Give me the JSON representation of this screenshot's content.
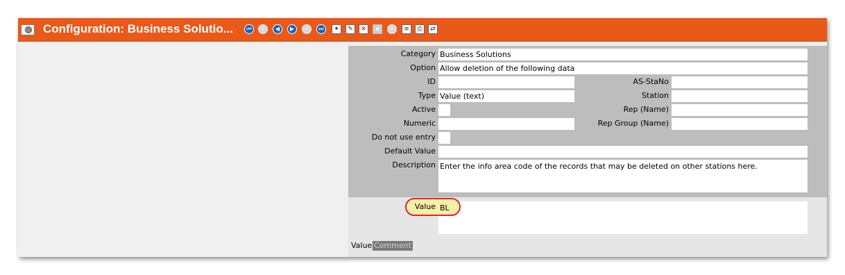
{
  "window": {
    "title": "Configuration: Business Solutio...",
    "accent": "#e8591a"
  },
  "toolbar": {
    "icons": [
      "first-record-icon",
      "previous-page-disabled-icon",
      "previous-record-icon",
      "next-record-icon",
      "next-page-disabled-icon",
      "last-record-icon",
      "new-record-icon",
      "edit-record-icon",
      "delete-record-icon",
      "save-disabled-icon",
      "cancel-disabled-icon",
      "list-view-icon",
      "print-icon",
      "export-icon"
    ]
  },
  "form": {
    "category": {
      "label": "Category",
      "value": "Business Solutions"
    },
    "option": {
      "label": "Option",
      "value": "Allow deletion of the following data"
    },
    "id": {
      "label": "ID",
      "value": ""
    },
    "as_stano": {
      "label": "AS-StaNo",
      "value": ""
    },
    "type": {
      "label": "Type",
      "value": "Value (text)"
    },
    "station": {
      "label": "Station",
      "value": ""
    },
    "active": {
      "label": "Active",
      "value": ""
    },
    "rep_name": {
      "label": "Rep (Name)",
      "value": ""
    },
    "numeric": {
      "label": "Numeric",
      "value": ""
    },
    "rep_group": {
      "label": "Rep Group (Name)",
      "value": ""
    },
    "do_not_use": {
      "label": "Do not use entry",
      "value": ""
    },
    "default_value": {
      "label": "Default Value",
      "value": ""
    },
    "description": {
      "label": "Description",
      "value": "Enter the info area code of the records that may be deleted on other stations here."
    },
    "value": {
      "label": "Value",
      "value": "BL"
    }
  },
  "tabs": [
    {
      "label": "Value"
    },
    {
      "label": "Comment"
    }
  ]
}
